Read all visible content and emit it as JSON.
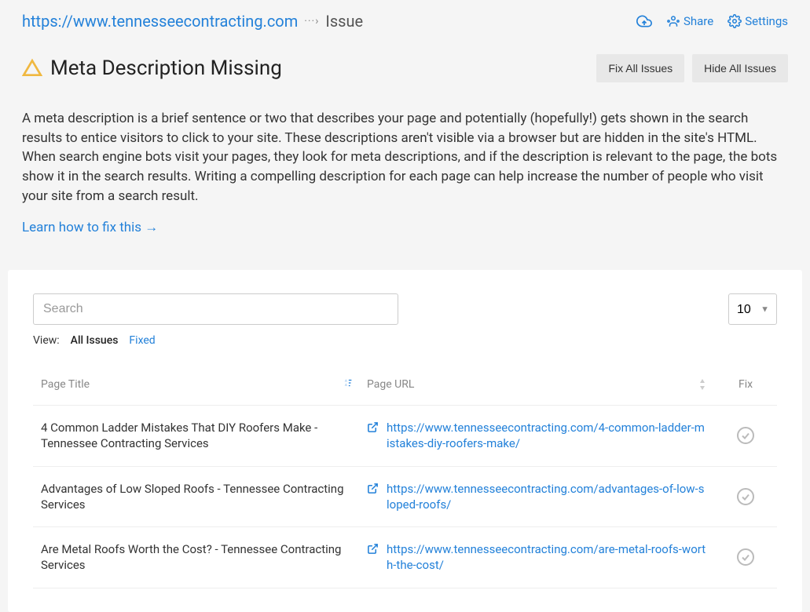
{
  "breadcrumb": {
    "site_url": "https://www.tennesseecontracting.com",
    "separator": "···›",
    "current": "Issue"
  },
  "header_actions": {
    "share": "Share",
    "settings": "Settings"
  },
  "title": "Meta Description Missing",
  "buttons": {
    "fix_all": "Fix All Issues",
    "hide_all": "Hide All Issues"
  },
  "description": "A meta description is a brief sentence or two that describes your page and potentially (hopefully!) gets shown in the search results to entice visitors to click to your site. These descriptions aren't visible via a browser but are hidden in the site's HTML. When search engine bots visit your pages, they look for meta descriptions, and if the description is relevant to the page, the bots show it in the search results. Writing a compelling description for each page can help increase the number of people who visit your site from a search result.",
  "learn_link": "Learn how to fix this →",
  "search": {
    "placeholder": "Search"
  },
  "view": {
    "label": "View:",
    "all_issues": "All Issues",
    "fixed": "Fixed"
  },
  "page_size": "10",
  "columns": {
    "title": "Page Title",
    "url": "Page URL",
    "fix": "Fix"
  },
  "rows": [
    {
      "title": "4 Common Ladder Mistakes That DIY Roofers Make - Tennessee Contracting Services",
      "url": "https://www.tennesseecontracting.com/4-common-ladder-mistakes-diy-roofers-make/"
    },
    {
      "title": "Advantages of Low Sloped Roofs - Tennessee Contracting Services",
      "url": "https://www.tennesseecontracting.com/advantages-of-low-sloped-roofs/"
    },
    {
      "title": "Are Metal Roofs Worth the Cost? - Tennessee Contracting Services",
      "url": "https://www.tennesseecontracting.com/are-metal-roofs-worth-the-cost/"
    }
  ]
}
